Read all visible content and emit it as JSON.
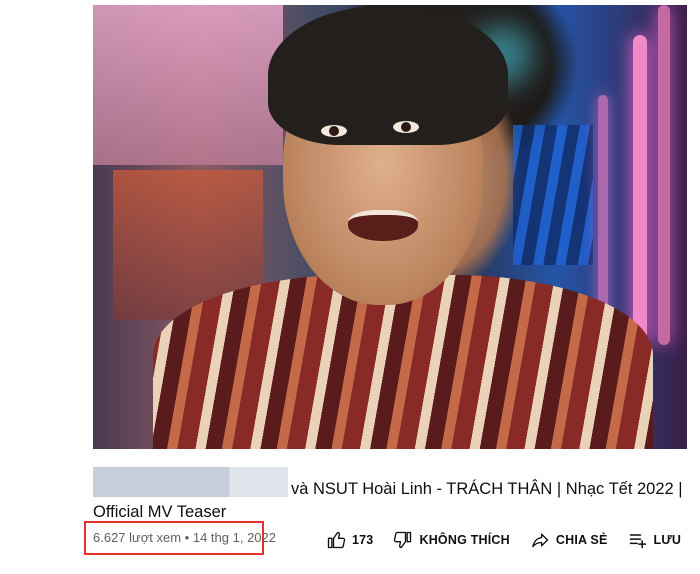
{
  "video": {
    "title_visible": "và NSUT Hoài Linh - TRÁCH THÂN | Nhạc Tết 2022 | Official MV Teaser"
  },
  "meta": {
    "views": "6.627 lượt xem",
    "separator": "•",
    "date": "14 thg 1, 2022"
  },
  "actions": {
    "like_count": "173",
    "dislike_label": "KHÔNG THÍCH",
    "share_label": "CHIA SẺ",
    "save_label": "LƯU",
    "more_label": "..."
  },
  "colors": {
    "highlight_border": "#e5322d",
    "meta_text": "#606060"
  }
}
